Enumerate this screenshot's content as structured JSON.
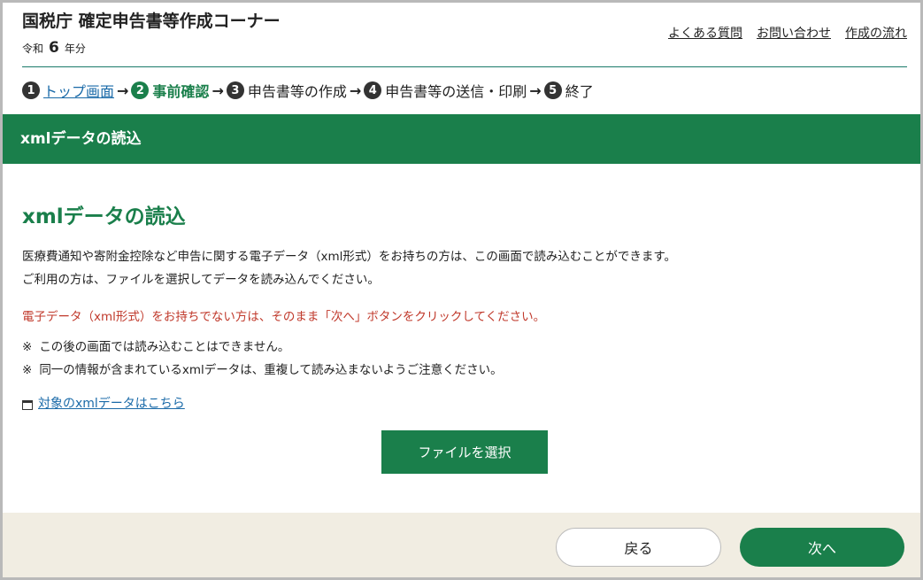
{
  "header": {
    "title": "国税庁 確定申告書等作成コーナー",
    "year_prefix": "令和",
    "year_number": "6",
    "year_suffix": "年分",
    "links": [
      "よくある質問",
      "お問い合わせ",
      "作成の流れ"
    ]
  },
  "steps": [
    {
      "num": "1",
      "label": "トップ画面"
    },
    {
      "num": "2",
      "label": "事前確認"
    },
    {
      "num": "3",
      "label": "申告書等の作成"
    },
    {
      "num": "4",
      "label": "申告書等の送信・印刷"
    },
    {
      "num": "5",
      "label": "終了"
    }
  ],
  "banner": {
    "title": "xmlデータの読込"
  },
  "main": {
    "heading": "xmlデータの読込",
    "para1": "医療費通知や寄附金控除など申告に関する電子データ（xml形式）をお持ちの方は、この画面で読み込むことができます。",
    "para2": "ご利用の方は、ファイルを選択してデータを読み込んでください。",
    "warning": "電子データ（xml形式）をお持ちでない方は、そのまま「次へ」ボタンをクリックしてください。",
    "note_mark": "※",
    "notes": [
      "この後の画面では読み込むことはできません。",
      "同一の情報が含まれているxmlデータは、重複して読み込まないようご注意ください。"
    ],
    "link_label": "対象のxmlデータはこちら",
    "file_button": "ファイルを選択"
  },
  "footer": {
    "back": "戻る",
    "next": "次へ"
  },
  "colors": {
    "primary_green": "#1a7f4b",
    "warning_red": "#c0392b",
    "link_blue": "#1a6aa8",
    "footer_bg": "#f1ede2"
  }
}
